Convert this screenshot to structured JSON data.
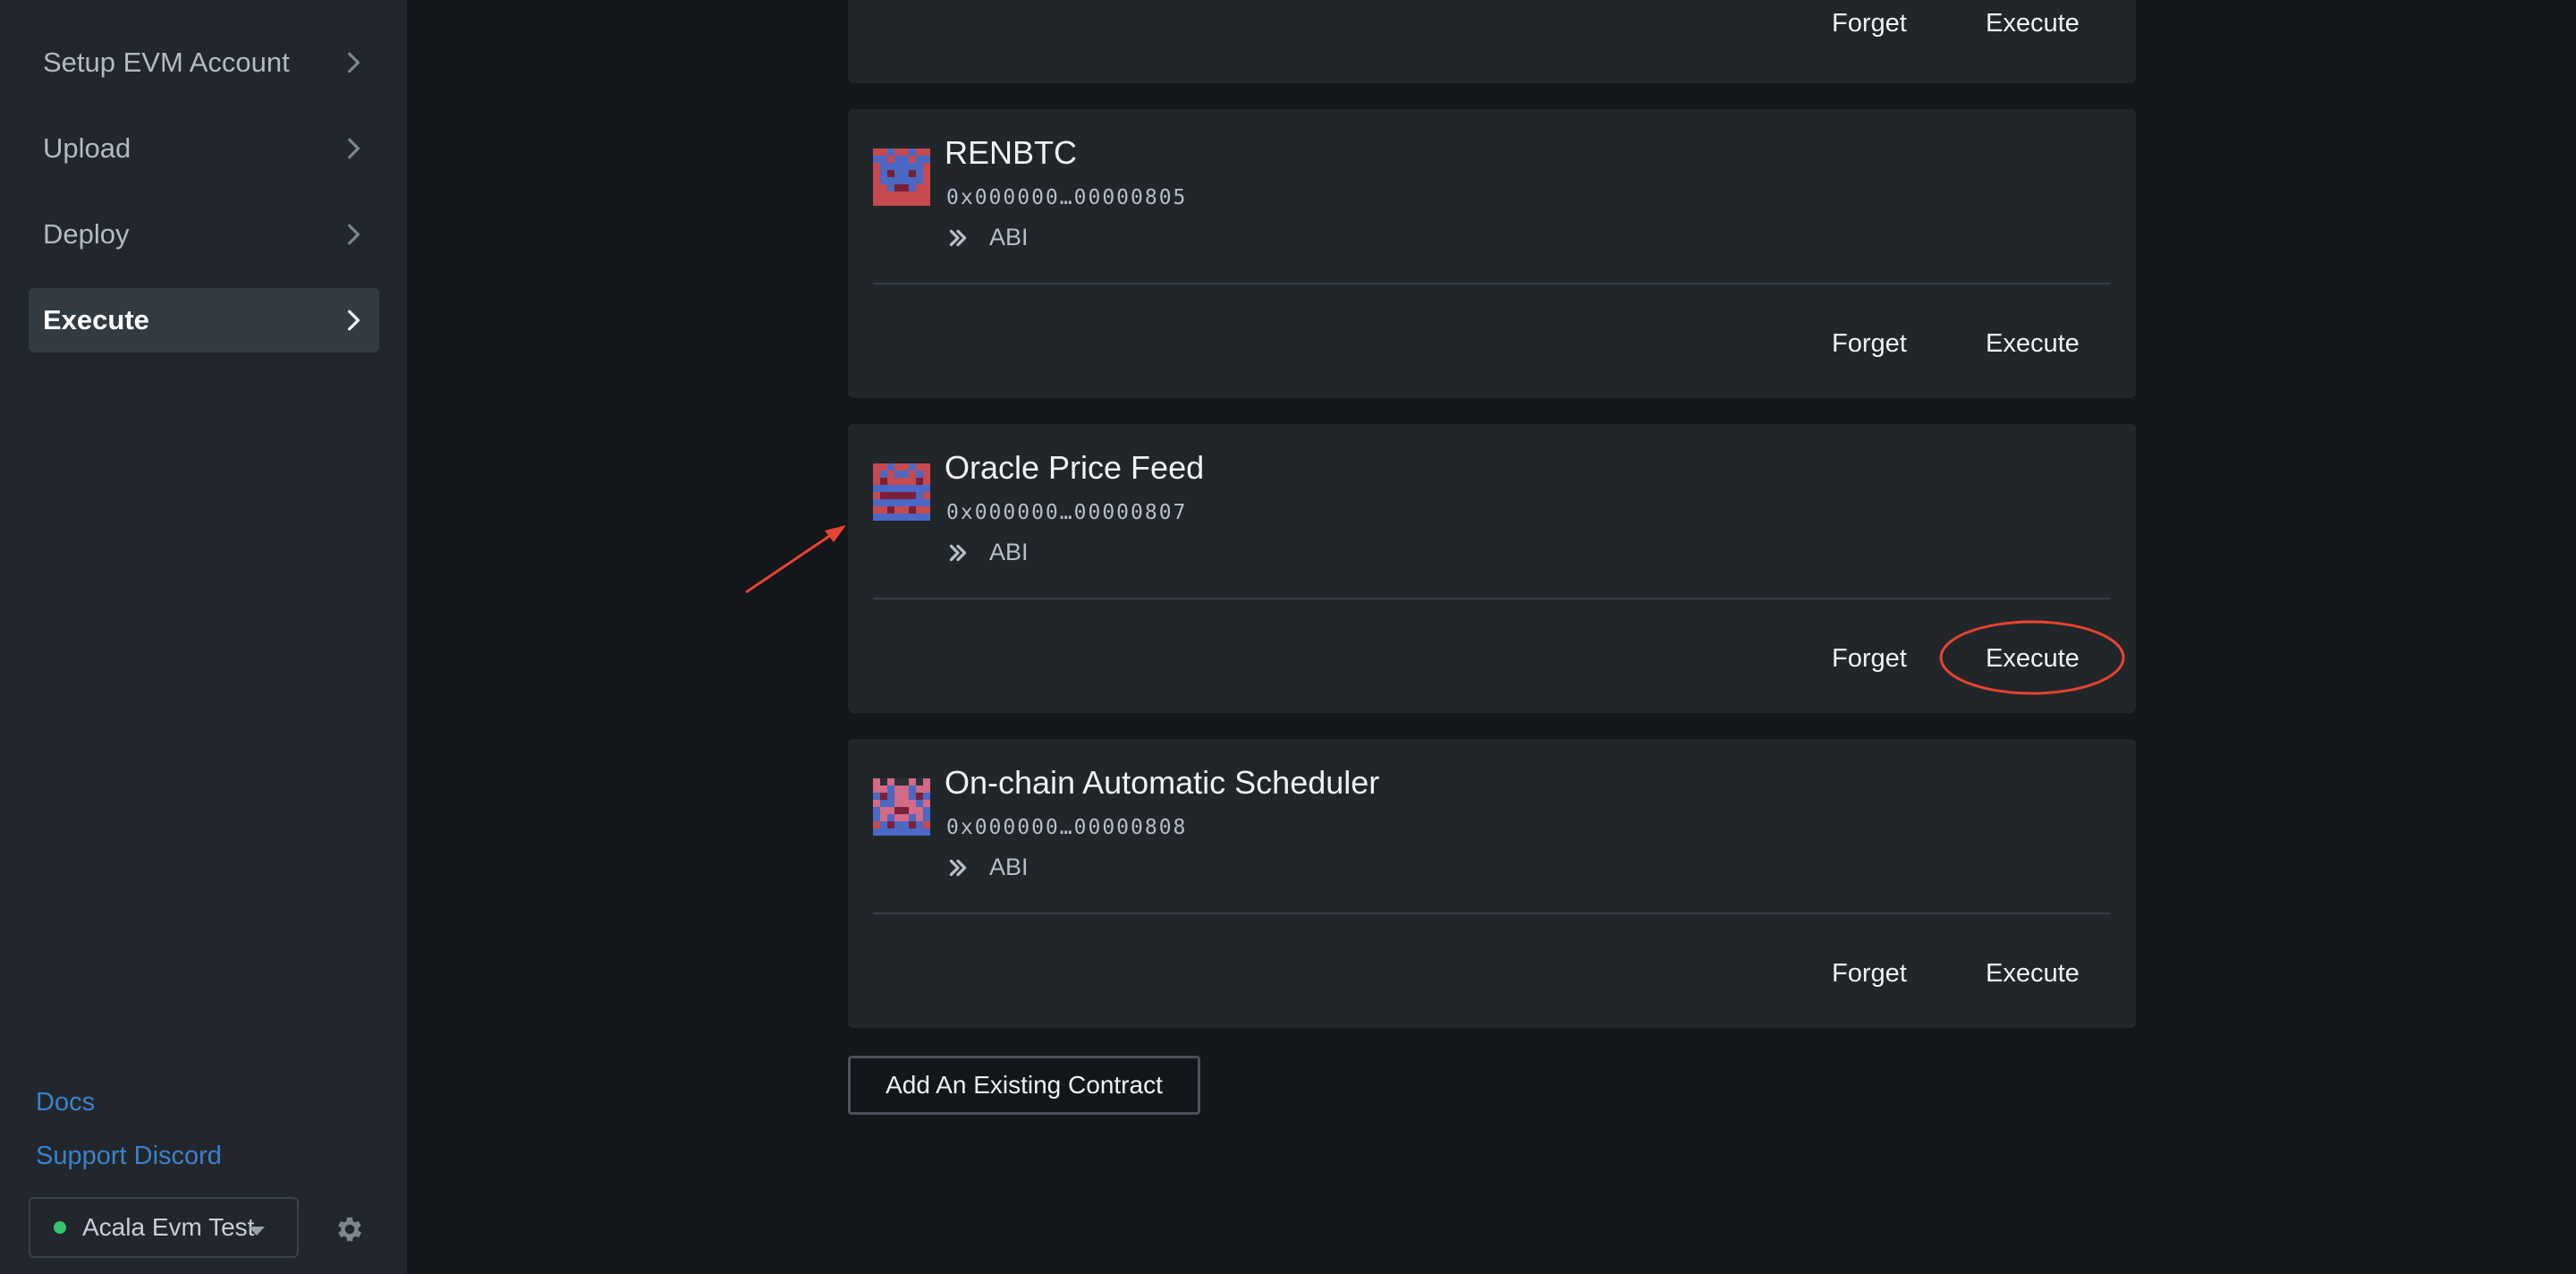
{
  "sidebar": {
    "nav": [
      {
        "label": "Setup EVM Account",
        "active": false
      },
      {
        "label": "Upload",
        "active": false
      },
      {
        "label": "Deploy",
        "active": false
      },
      {
        "label": "Execute",
        "active": true
      }
    ],
    "links": {
      "docs": "Docs",
      "support": "Support Discord"
    },
    "network": {
      "name": "Acala Evm Test",
      "status_color": "#39c36a"
    }
  },
  "contracts": [
    {
      "name": "",
      "address": "",
      "abi_label": "",
      "forget_label": "Forget",
      "execute_label": "Execute"
    },
    {
      "name": "RENBTC",
      "address": "0x000000…00000805",
      "abi_label": "ABI",
      "forget_label": "Forget",
      "execute_label": "Execute"
    },
    {
      "name": "Oracle Price Feed",
      "address": "0x000000…00000807",
      "abi_label": "ABI",
      "forget_label": "Forget",
      "execute_label": "Execute"
    },
    {
      "name": "On-chain Automatic Scheduler",
      "address": "0x000000…00000808",
      "abi_label": "ABI",
      "forget_label": "Forget",
      "execute_label": "Execute"
    }
  ],
  "add_contract_label": "Add An Existing Contract",
  "annotation_color": "#e8432f",
  "icons": {
    "chevron": "chevron-right-icon",
    "abi": "double-chevron-right-icon",
    "settings": "gear-icon"
  }
}
